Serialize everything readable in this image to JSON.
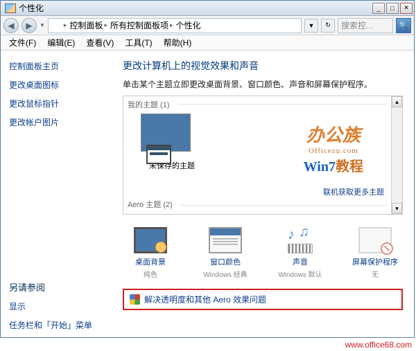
{
  "titlebar": {
    "title": "个性化"
  },
  "nav": {
    "breadcrumb": [
      "控制面板",
      "所有控制面板项",
      "个性化"
    ],
    "search_placeholder": "搜索控..."
  },
  "menubar": [
    "文件(F)",
    "编辑(E)",
    "查看(V)",
    "工具(T)",
    "帮助(H)"
  ],
  "sidebar": {
    "links": [
      "控制面板主页",
      "更改桌面图标",
      "更改鼠标指针",
      "更改帐户图片"
    ],
    "see_also_title": "另请参阅",
    "see_also": [
      "显示",
      "任务栏和「开始」菜单"
    ]
  },
  "main": {
    "heading": "更改计算机上的视觉效果和声音",
    "desc": "单击某个主题立即更改桌面背景、窗口颜色、声音和屏幕保护程序。",
    "group_my_themes": "我的主题 (1)",
    "unsaved_theme_caption": "未保存的主题",
    "more_themes_link": "联机获取更多主题",
    "group_aero": "Aero 主题 (2)",
    "customize": [
      {
        "label": "桌面背景",
        "value": "纯色"
      },
      {
        "label": "窗口颜色",
        "value": "Windows 经典"
      },
      {
        "label": "声音",
        "value": "Windows 默认"
      },
      {
        "label": "屏幕保护程序",
        "value": "无"
      }
    ],
    "troubleshoot_link": "解决透明度和其他 Aero 效果问题"
  },
  "watermark": {
    "brand": "办公族",
    "domain": "Officezu.com",
    "win7": "Win7",
    "guide": "教程"
  },
  "footer_url": "www.office68.com"
}
